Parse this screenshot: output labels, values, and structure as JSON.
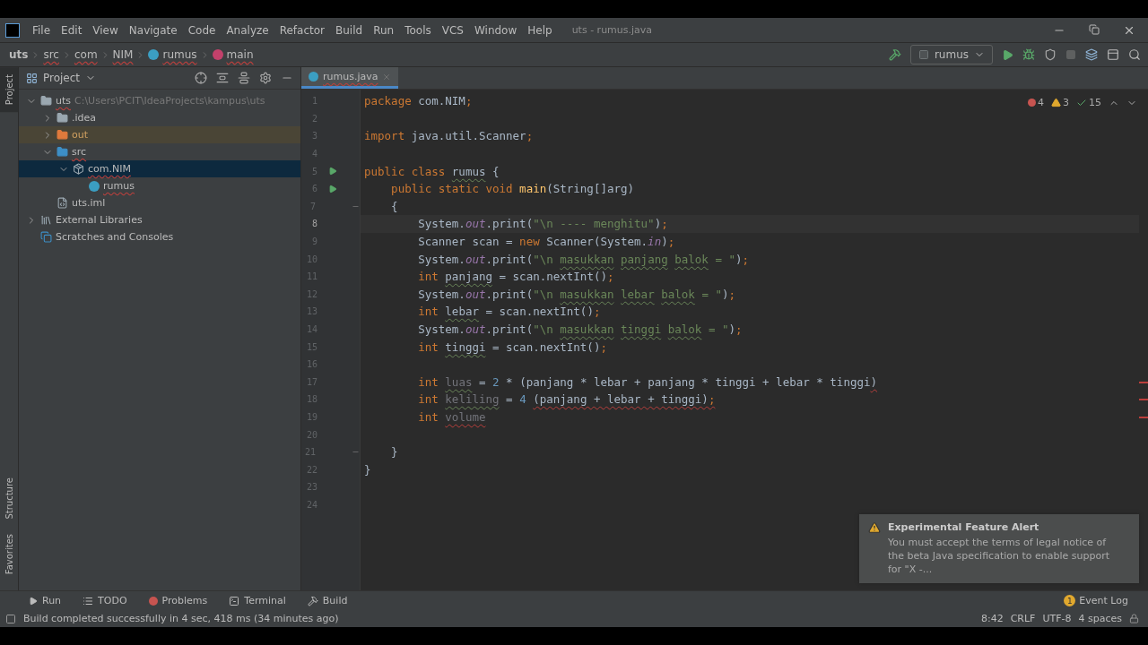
{
  "window": {
    "title": "uts - rumus.java",
    "menu": [
      "File",
      "Edit",
      "View",
      "Navigate",
      "Code",
      "Analyze",
      "Refactor",
      "Build",
      "Run",
      "Tools",
      "VCS",
      "Window",
      "Help"
    ]
  },
  "breadcrumbs": [
    {
      "label": "uts",
      "kind": "module",
      "error": false
    },
    {
      "label": "src",
      "kind": "folder",
      "error": true
    },
    {
      "label": "com",
      "kind": "folder",
      "error": true
    },
    {
      "label": "NIM",
      "kind": "folder",
      "error": true
    },
    {
      "label": "rumus",
      "kind": "class",
      "error": true
    },
    {
      "label": "main",
      "kind": "method",
      "error": true
    }
  ],
  "run_config": {
    "label": "rumus"
  },
  "toolbar": [
    {
      "kind": "build",
      "disabled": false
    },
    {
      "kind": "run",
      "disabled": false
    },
    {
      "kind": "debug",
      "disabled": false
    },
    {
      "kind": "coverage",
      "disabled": false
    },
    {
      "kind": "stop",
      "disabled": true
    },
    {
      "kind": "structure",
      "disabled": false
    },
    {
      "kind": "terminal",
      "disabled": false
    },
    {
      "kind": "search",
      "disabled": false
    }
  ],
  "side_stripe": [
    {
      "label": "Project",
      "selected": true
    },
    {
      "label": "Structure",
      "selected": false
    },
    {
      "label": "Favorites",
      "selected": false
    }
  ],
  "project": {
    "title": "Project",
    "tree": [
      {
        "label": "uts",
        "hint": "C:\\Users\\PCIT\\IdeaProjects\\kampus\\uts",
        "kind": "module",
        "expanded": true,
        "selected": false,
        "excluded": false,
        "error": true,
        "children": [
          {
            "label": ".idea",
            "kind": "folder",
            "expanded": false,
            "selected": false,
            "excluded": false,
            "error": false
          },
          {
            "label": "out",
            "kind": "excluded-folder",
            "expanded": false,
            "selected": false,
            "excluded": true,
            "error": false
          },
          {
            "label": "src",
            "kind": "source-folder",
            "expanded": true,
            "selected": false,
            "excluded": false,
            "error": true,
            "children": [
              {
                "label": "com.NIM",
                "kind": "package",
                "expanded": true,
                "selected": true,
                "excluded": false,
                "error": true,
                "children": [
                  {
                    "label": "rumus",
                    "kind": "class",
                    "selected": false,
                    "excluded": false,
                    "error": true
                  }
                ]
              }
            ]
          },
          {
            "label": "uts.iml",
            "kind": "iml",
            "selected": false,
            "excluded": false,
            "error": false
          }
        ]
      },
      {
        "label": "External Libraries",
        "kind": "libraries",
        "expanded": false,
        "selected": false,
        "excluded": false,
        "error": false
      },
      {
        "label": "Scratches and Consoles",
        "kind": "scratches",
        "selected": false,
        "excluded": false,
        "error": false
      }
    ]
  },
  "editor": {
    "tabs": [
      {
        "label": "rumus.java",
        "selected": true
      }
    ],
    "inspections": [
      {
        "kind": "error",
        "count": "4"
      },
      {
        "kind": "warning",
        "count": "3"
      },
      {
        "kind": "typo",
        "count": "15"
      }
    ],
    "lines": [
      {
        "number": "1",
        "current": false,
        "kind": "plain",
        "tokens": [
          {
            "text": "package",
            "kind": "kw"
          },
          {
            "text": " com.NIM",
            "kind": "plain"
          },
          {
            "text": ";",
            "kind": "kw"
          }
        ]
      },
      {
        "number": "2",
        "current": false,
        "kind": "plain"
      },
      {
        "number": "3",
        "current": false,
        "kind": "plain",
        "tokens": [
          {
            "text": "import",
            "kind": "kw"
          },
          {
            "text": " java.util.Scanner",
            "kind": "plain"
          },
          {
            "text": ";",
            "kind": "kw"
          }
        ]
      },
      {
        "number": "4",
        "current": false,
        "kind": "plain"
      },
      {
        "number": "5",
        "current": false,
        "kind": "run",
        "tokens": [
          {
            "text": "public class",
            "kind": "kw"
          },
          {
            "text": " rumus",
            "kind": "plain-typo"
          },
          {
            "text": " {",
            "kind": "plain"
          }
        ]
      },
      {
        "number": "6",
        "current": false,
        "kind": "run",
        "tokens": [
          {
            "text": "    public static void",
            "kind": "kw"
          },
          {
            "text": " main",
            "kind": "method"
          },
          {
            "text": "(String[]arg)",
            "kind": "plain"
          }
        ]
      },
      {
        "number": "7",
        "current": false,
        "kind": "fold",
        "tokens": [
          {
            "text": "    {",
            "kind": "plain"
          }
        ]
      },
      {
        "number": "8",
        "current": true,
        "kind": "plain",
        "tokens": [
          {
            "text": "        System.",
            "kind": "plain"
          },
          {
            "text": "out",
            "kind": "field"
          },
          {
            "text": ".print(",
            "kind": "plain"
          },
          {
            "text": "\"\\n ---- menghitu\"",
            "kind": "str"
          },
          {
            "text": ")",
            "kind": "plain"
          },
          {
            "text": ";",
            "kind": "kw"
          }
        ]
      },
      {
        "number": "9",
        "current": false,
        "kind": "plain",
        "tokens": [
          {
            "text": "        Scanner scan =",
            "kind": "plain"
          },
          {
            "text": " new",
            "kind": "kw"
          },
          {
            "text": " Scanner(System.",
            "kind": "plain"
          },
          {
            "text": "in",
            "kind": "field"
          },
          {
            "text": ")",
            "kind": "plain"
          },
          {
            "text": ";",
            "kind": "kw"
          }
        ]
      },
      {
        "number": "10",
        "current": false,
        "kind": "plain",
        "tokens": [
          {
            "text": "        System.",
            "kind": "plain"
          },
          {
            "text": "out",
            "kind": "field"
          },
          {
            "text": ".print(",
            "kind": "plain"
          },
          {
            "text": "\"\\n",
            "kind": "str"
          },
          {
            "text": " masukkan",
            "kind": "str-typo"
          },
          {
            "text": " panjang",
            "kind": "str-typo"
          },
          {
            "text": " balok",
            "kind": "str-typo"
          },
          {
            "text": " = \"",
            "kind": "str"
          },
          {
            "text": ")",
            "kind": "plain"
          },
          {
            "text": ";",
            "kind": "kw"
          }
        ]
      },
      {
        "number": "11",
        "current": false,
        "kind": "plain",
        "tokens": [
          {
            "text": "        int",
            "kind": "kw"
          },
          {
            "text": " panjang",
            "kind": "plain-typo"
          },
          {
            "text": " = scan.nextInt()",
            "kind": "plain"
          },
          {
            "text": ";",
            "kind": "kw"
          }
        ]
      },
      {
        "number": "12",
        "current": false,
        "kind": "plain",
        "tokens": [
          {
            "text": "        System.",
            "kind": "plain"
          },
          {
            "text": "out",
            "kind": "field"
          },
          {
            "text": ".print(",
            "kind": "plain"
          },
          {
            "text": "\"\\n",
            "kind": "str"
          },
          {
            "text": " masukkan",
            "kind": "str-typo"
          },
          {
            "text": " lebar",
            "kind": "str-typo"
          },
          {
            "text": " balok",
            "kind": "str-typo"
          },
          {
            "text": " = \"",
            "kind": "str"
          },
          {
            "text": ")",
            "kind": "plain"
          },
          {
            "text": ";",
            "kind": "kw"
          }
        ]
      },
      {
        "number": "13",
        "current": false,
        "kind": "plain",
        "tokens": [
          {
            "text": "        int",
            "kind": "kw"
          },
          {
            "text": " lebar",
            "kind": "plain-typo"
          },
          {
            "text": " = scan.nextInt()",
            "kind": "plain"
          },
          {
            "text": ";",
            "kind": "kw"
          }
        ]
      },
      {
        "number": "14",
        "current": false,
        "kind": "plain",
        "tokens": [
          {
            "text": "        System.",
            "kind": "plain"
          },
          {
            "text": "out",
            "kind": "field"
          },
          {
            "text": ".print(",
            "kind": "plain"
          },
          {
            "text": "\"\\n",
            "kind": "str"
          },
          {
            "text": " masukkan",
            "kind": "str-typo"
          },
          {
            "text": " tinggi",
            "kind": "str-typo"
          },
          {
            "text": " balok",
            "kind": "str-typo"
          },
          {
            "text": " = \"",
            "kind": "str"
          },
          {
            "text": ")",
            "kind": "plain"
          },
          {
            "text": ";",
            "kind": "kw"
          }
        ]
      },
      {
        "number": "15",
        "current": false,
        "kind": "plain",
        "tokens": [
          {
            "text": "        int",
            "kind": "kw"
          },
          {
            "text": " tinggi",
            "kind": "plain-typo"
          },
          {
            "text": " = scan.nextInt()",
            "kind": "plain"
          },
          {
            "text": ";",
            "kind": "kw"
          }
        ]
      },
      {
        "number": "16",
        "current": false,
        "kind": "plain"
      },
      {
        "number": "17",
        "current": false,
        "kind": "plain",
        "tokens": [
          {
            "text": "        int",
            "kind": "kw"
          },
          {
            "text": " luas",
            "kind": "unused-typo"
          },
          {
            "text": " =",
            "kind": "plain"
          },
          {
            "text": " 2",
            "kind": "num"
          },
          {
            "text": " * (panjang * lebar + panjang * tinggi + lebar * tinggi",
            "kind": "plain"
          },
          {
            "text": ")",
            "kind": "plain-error"
          }
        ]
      },
      {
        "number": "18",
        "current": false,
        "kind": "plain",
        "tokens": [
          {
            "text": "        int",
            "kind": "kw"
          },
          {
            "text": " keliling",
            "kind": "unused-typo"
          },
          {
            "text": " =",
            "kind": "plain"
          },
          {
            "text": " 4",
            "kind": "num"
          },
          {
            "text": " (panjang + lebar + tinggi)",
            "kind": "plain-error"
          },
          {
            "text": ";",
            "kind": "kw-error"
          }
        ]
      },
      {
        "number": "19",
        "current": false,
        "kind": "plain",
        "tokens": [
          {
            "text": "        int",
            "kind": "kw"
          },
          {
            "text": " volume",
            "kind": "unused-error"
          }
        ]
      },
      {
        "number": "20",
        "current": false,
        "kind": "plain"
      },
      {
        "number": "21",
        "current": false,
        "kind": "fold",
        "tokens": [
          {
            "text": "    }",
            "kind": "plain"
          }
        ]
      },
      {
        "number": "22",
        "current": false,
        "kind": "plain",
        "tokens": [
          {
            "text": "}",
            "kind": "plain"
          }
        ]
      },
      {
        "number": "23",
        "current": false,
        "kind": "plain"
      },
      {
        "number": "24",
        "current": false,
        "kind": "plain"
      }
    ]
  },
  "notification": {
    "title": "Experimental Feature Alert",
    "body": "You must accept the terms of legal notice of the beta Java specification to enable support for \"X -..."
  },
  "tool_windows": [
    {
      "label": "Run",
      "kind": "run"
    },
    {
      "label": "TODO",
      "kind": "todo"
    },
    {
      "label": "Problems",
      "kind": "problems"
    },
    {
      "label": "Terminal",
      "kind": "terminal"
    },
    {
      "label": "Build",
      "kind": "build"
    }
  ],
  "event_log": {
    "label": "Event Log",
    "badge": "1"
  },
  "status_bar": {
    "message": "Build completed successfully in 4 sec, 418 ms (34 minutes ago)",
    "items": [
      "8:42",
      "CRLF",
      "UTF-8",
      "4 spaces"
    ]
  }
}
